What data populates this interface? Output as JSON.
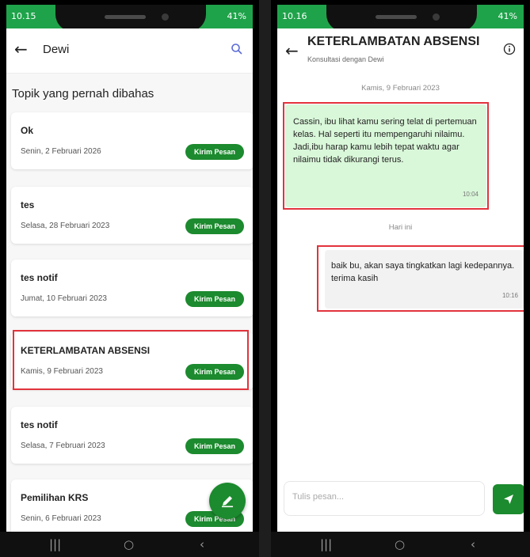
{
  "left": {
    "status": {
      "time": "10.15",
      "battery": "41%"
    },
    "header": {
      "title": "Dewi"
    },
    "section_title": "Topik yang pernah dibahas",
    "topics": [
      {
        "title": "Ok",
        "date": "Senin, 2 Februari 2026",
        "button": "Kirim Pesan"
      },
      {
        "title": "tes",
        "date": "Selasa, 28 Februari 2023",
        "button": "Kirim Pesan"
      },
      {
        "title": "tes notif",
        "date": "Jumat, 10 Februari 2023",
        "button": "Kirim Pesan"
      },
      {
        "title": "KETERLAMBATAN ABSENSI",
        "date": "Kamis, 9 Februari 2023",
        "button": "Kirim Pesan"
      },
      {
        "title": "tes notif",
        "date": "Selasa, 7 Februari 2023",
        "button": "Kirim Pesan"
      },
      {
        "title": "Pemilihan KRS",
        "date": "Senin, 6 Februari 2023",
        "button": "Kirim Pesan"
      }
    ]
  },
  "right": {
    "status": {
      "time": "10.16",
      "battery": "41%"
    },
    "header": {
      "title": "KETERLAMBATAN ABSENSI",
      "subtitle": "Konsultasi dengan Dewi"
    },
    "date_chip_1": "Kamis, 9 Februari 2023",
    "incoming": {
      "text": "Cassin, ibu lihat kamu sering telat di pertemuan kelas. Hal seperti itu mempengaruhi nilaimu. Jadi,ibu harap kamu lebih tepat waktu agar nilaimu tidak dikurangi terus.",
      "time": "10:04"
    },
    "date_chip_2": "Hari ini",
    "outgoing": {
      "text": "baik bu, akan saya tingkatkan lagi kedepannya. terima kasih",
      "time": "10:16"
    },
    "input": {
      "placeholder": "Tulis pesan...",
      "value": ""
    }
  },
  "nav_icons": [
    "recent-apps-icon",
    "home-icon",
    "back-icon"
  ],
  "colors": {
    "primary_green": "#1c8a2e",
    "status_green": "#1fa34a",
    "bubble_green": "#d9f7d9",
    "highlight_red": "#e2333d"
  }
}
